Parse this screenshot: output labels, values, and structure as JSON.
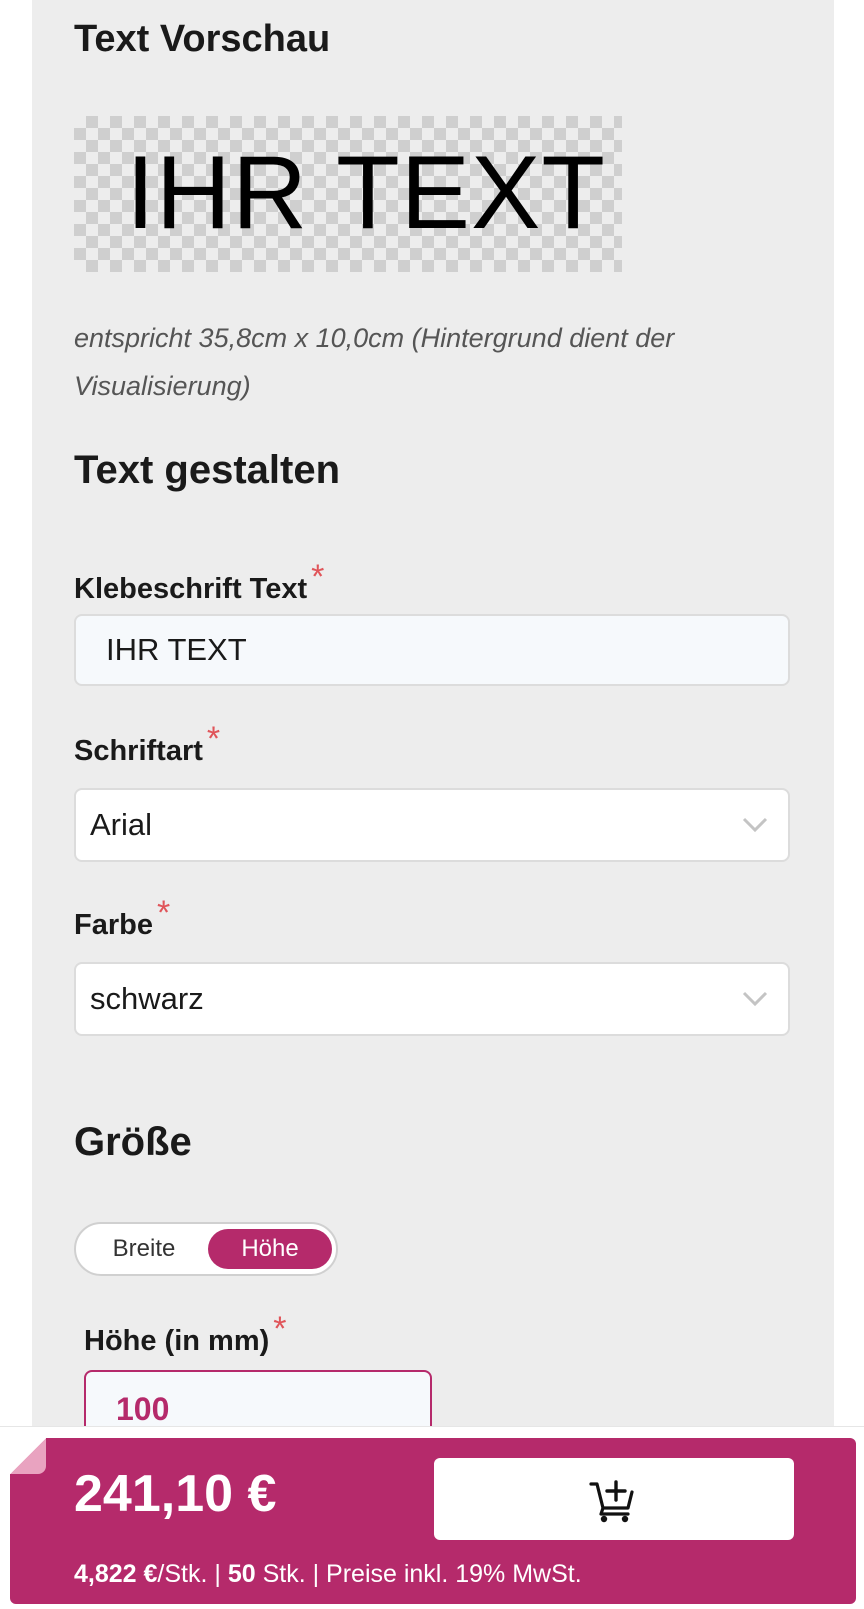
{
  "preview": {
    "heading": "Text Vorschau",
    "sample_text": "IHR TEXT",
    "note": "entspricht 35,8cm x 10,0cm (Hintergrund dient der Visualisierung)"
  },
  "design": {
    "heading": "Text gestalten",
    "text_label": "Klebeschrift Text",
    "text_value": "IHR TEXT",
    "font_label": "Schriftart",
    "font_value": "Arial",
    "color_label": "Farbe",
    "color_value": "schwarz",
    "required_mark": "*"
  },
  "size": {
    "heading": "Größe",
    "toggle": {
      "option_width": "Breite",
      "option_height": "Höhe",
      "selected": "Höhe"
    },
    "height_label": "Höhe (in mm)",
    "height_value": "100"
  },
  "price": {
    "total": "241,10 €",
    "unit_price": "4,822 €",
    "unit_suffix": "/Stk. | ",
    "quantity": "50",
    "quantity_suffix": " Stk. | Preise inkl. 19% MwSt."
  },
  "colors": {
    "accent": "#b52a6b",
    "panel": "#ededed",
    "required": "#e0555a"
  },
  "icons": {
    "cart": "cart-add-icon",
    "chevron": "chevron-down-icon"
  }
}
